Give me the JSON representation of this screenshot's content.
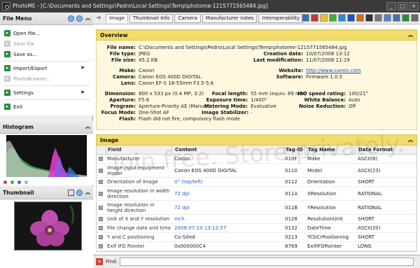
{
  "window": {
    "title": "PhotoME - [C:\\Documents and Settings\\Pedro\\Local Settings\\Temp\\photome-1215771565484.jpg]"
  },
  "sidebar": {
    "filemenu": {
      "title": "File Menu",
      "items": [
        {
          "label": "Open file...",
          "enabled": true
        },
        {
          "label": "Save file",
          "enabled": false
        },
        {
          "label": "Save as...",
          "enabled": true
        },
        {
          "label": "Import/Export",
          "enabled": true
        },
        {
          "label": "PhotoBrowser...",
          "enabled": false
        },
        {
          "label": "Settings",
          "enabled": true
        },
        {
          "label": "Exit",
          "enabled": true
        }
      ]
    },
    "histogram": {
      "title": "Histogram",
      "dot_colors": [
        "#d84040",
        "#3fae3f",
        "#3a6fd8",
        "#b0b0b0"
      ]
    },
    "thumbnail": {
      "title": "Thumbnail"
    }
  },
  "tabs": [
    {
      "label": "Image",
      "active": true
    },
    {
      "label": "Thumbnail Info",
      "active": false
    },
    {
      "label": "Camera",
      "active": false
    },
    {
      "label": "Manufacturer notes",
      "active": false
    },
    {
      "label": "Interoperability",
      "active": false
    }
  ],
  "toolbar_icons": [
    "camera-icon",
    "flower-icon",
    "star-icon",
    "color-icon",
    "globe-icon",
    "info-icon",
    "vr-icon",
    "bw-icon",
    "gear-icon",
    "folder-icon",
    "save-icon",
    "print-icon",
    "help-icon"
  ],
  "overview": {
    "title": "Overview",
    "file_name_label": "File name:",
    "file_name": "C:\\Documents and Settings\\Pedro\\Local Settings\\Temp\\photome-1215771565484.jpg",
    "file_type_label": "File type:",
    "file_type": "JPEG",
    "file_size_label": "File size:",
    "file_size": "45.2 KB",
    "creation_date_label": "Creation date:",
    "creation_date": "10/07/2008 13:12",
    "last_modification_label": "Last modification:",
    "last_modification": "11/07/2008 11:19",
    "make_label": "Make:",
    "make": "Canon",
    "camera_label": "Camera:",
    "camera": "Canon EOS 400D DIGITAL",
    "lens_label": "Lens:",
    "lens": "Canon EF-S 18-55mm F3.5-5.6",
    "website_label": "Website:",
    "website": "http://www.canon.com",
    "software_label": "Software:",
    "software": "Firmware 1.0.5",
    "dimension_label": "Dimension:",
    "dimension": "800 x 533 px (0.4 MP, 3:2)",
    "aperture_label": "Aperture:",
    "aperture": "F5.6",
    "program_label": "Program:",
    "program": "Aperture-Priority AE (Manual)",
    "focus_mode_label": "Focus Mode:",
    "focus_mode": "One-Shot AF",
    "flash_label": "Flash:",
    "flash": "Flash did not fire, compulsory flash mode",
    "focal_length_label": "Focal length:",
    "focal_length": "55 mm (equiv. 89 mm)",
    "exposure_time_label": "Exposure time:",
    "exposure_time": "1/400\"",
    "metering_mode_label": "Metering Mode:",
    "metering_mode": "Evaluative",
    "image_stabilizer_label": "Image Stabilizer:",
    "image_stabilizer": "-",
    "iso_label": "ISO speed rating:",
    "iso": "100/21°",
    "white_balance_label": "White Balance:",
    "white_balance": "Auto",
    "noise_reduction_label": "Noise Reduction:",
    "noise_reduction": "Off"
  },
  "image_section": {
    "title": "Image",
    "columns": [
      "Field",
      "Content",
      "Tag-ID",
      "Tag Name",
      "Data Format"
    ],
    "rows": [
      {
        "field": "Manufacturer",
        "content": "Canon",
        "tag": "010F",
        "name": "Make",
        "format": "ASCII(6)",
        "link": false
      },
      {
        "field": "Image input equipment model",
        "content": "Canon EOS 400D DIGITAL",
        "tag": "0110",
        "name": "Model",
        "format": "ASCII(23)",
        "link": false
      },
      {
        "field": "Orientation of image",
        "content": "0° (top/left)",
        "tag": "0112",
        "name": "Orientation",
        "format": "SHORT",
        "link": true
      },
      {
        "field": "Image resolution in width direction",
        "content": "72 dpi",
        "tag": "011A",
        "name": "XResolution",
        "format": "RATIONAL",
        "link": true
      },
      {
        "field": "Image resolution in height direction",
        "content": "72 dpi",
        "tag": "011B",
        "name": "YResolution",
        "format": "RATIONAL",
        "link": true
      },
      {
        "field": "Unit of X and Y resolution",
        "content": "inch",
        "tag": "0128",
        "name": "ResolutionUnit",
        "format": "SHORT",
        "link": true
      },
      {
        "field": "File change date and time",
        "content": "2008-07-10 13:12:57",
        "tag": "0132",
        "name": "DateTime",
        "format": "ASCII(20)",
        "link": true
      },
      {
        "field": "Y and C positioning",
        "content": "Co-Sited",
        "tag": "0213",
        "name": "YCbCrPositioning",
        "format": "SHORT",
        "link": false
      },
      {
        "field": "Exif IFD Pointer",
        "content": "0x000000C4",
        "tag": "8769",
        "name": "ExifIFDPointer",
        "format": "LONG",
        "link": false
      }
    ]
  },
  "findbar": {
    "label": "Find:",
    "value": ""
  },
  "watermark": "Join free. Store privately."
}
